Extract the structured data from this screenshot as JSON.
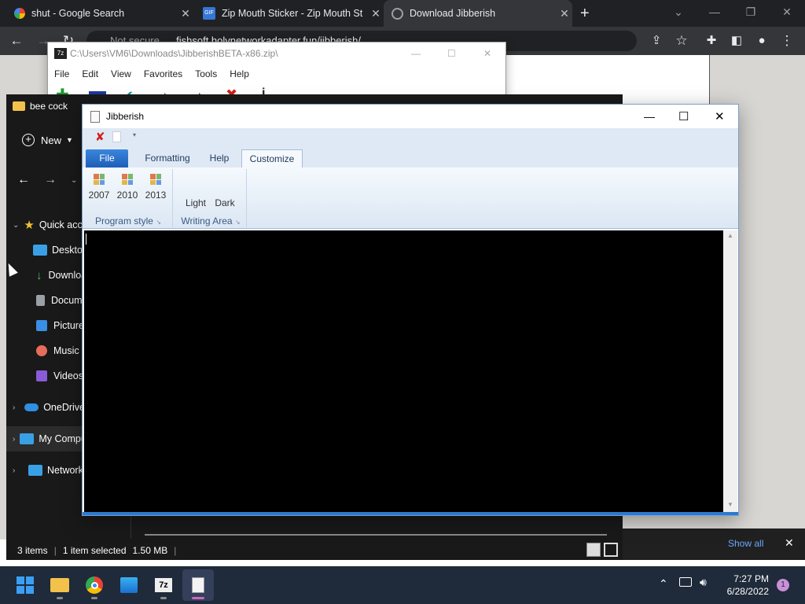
{
  "chrome": {
    "tabs": [
      {
        "title": "shut - Google Search",
        "active": false
      },
      {
        "title": "Zip Mouth Sticker - Zip Mouth St",
        "active": false
      },
      {
        "title": "Download Jibberish",
        "active": true
      }
    ],
    "new_tab": "+",
    "omnibox": {
      "security": "Not secure",
      "url": "fishsoft.holynetworkadapter.fun/jibberish/"
    }
  },
  "sevenzip": {
    "title": "C:\\Users\\VM6\\Downloads\\JibberishBETA-x86.zip\\",
    "menu": [
      "File",
      "Edit",
      "View",
      "Favorites",
      "Tools",
      "Help"
    ]
  },
  "explorer": {
    "title": "bee cock",
    "new_label": "New",
    "nav": [
      {
        "label": "Quick access",
        "icon": "star-icon",
        "color": "#f2c02f"
      },
      {
        "label": "Desktop",
        "icon": "desktop-icon",
        "color": "#3aa0e6"
      },
      {
        "label": "Downloads",
        "icon": "download-icon",
        "color": "#3cc46b"
      },
      {
        "label": "Documents",
        "icon": "document-icon",
        "color": "#9aa0a6"
      },
      {
        "label": "Pictures",
        "icon": "pictures-icon",
        "color": "#3a8ee6"
      },
      {
        "label": "Music",
        "icon": "music-icon",
        "color": "#e66d5a"
      },
      {
        "label": "Videos",
        "icon": "videos-icon",
        "color": "#8a5bd6"
      },
      {
        "label": "OneDrive",
        "icon": "onedrive-icon",
        "color": "#2f8fe0"
      },
      {
        "label": "My Computer",
        "icon": "computer-icon",
        "color": "#3aa0e6"
      },
      {
        "label": "Network",
        "icon": "network-icon",
        "color": "#3aa0e6"
      }
    ],
    "status": {
      "items": "3 items",
      "selected": "1 item selected",
      "size": "1.50 MB"
    }
  },
  "jibberish": {
    "title": "Jibberish",
    "ribbon_tabs": [
      "File",
      "Formatting",
      "Help",
      "Customize"
    ],
    "active_tab": "Customize",
    "program_style": {
      "label": "Program style",
      "buttons": [
        "2007",
        "2010",
        "2013"
      ]
    },
    "writing_area": {
      "label": "Writing Area",
      "buttons": [
        "Light",
        "Dark"
      ]
    }
  },
  "notification": {
    "show_all": "Show all"
  },
  "taskbar": {
    "time": "7:27 PM",
    "date": "6/28/2022",
    "badge": "1"
  },
  "colors": {
    "chrome_bg": "#202124",
    "explorer_bg": "#191919",
    "ribbon_file_tab": "#2b6cc4",
    "editor_bg": "#000000",
    "taskbar_bg": "#1f2a3a"
  }
}
